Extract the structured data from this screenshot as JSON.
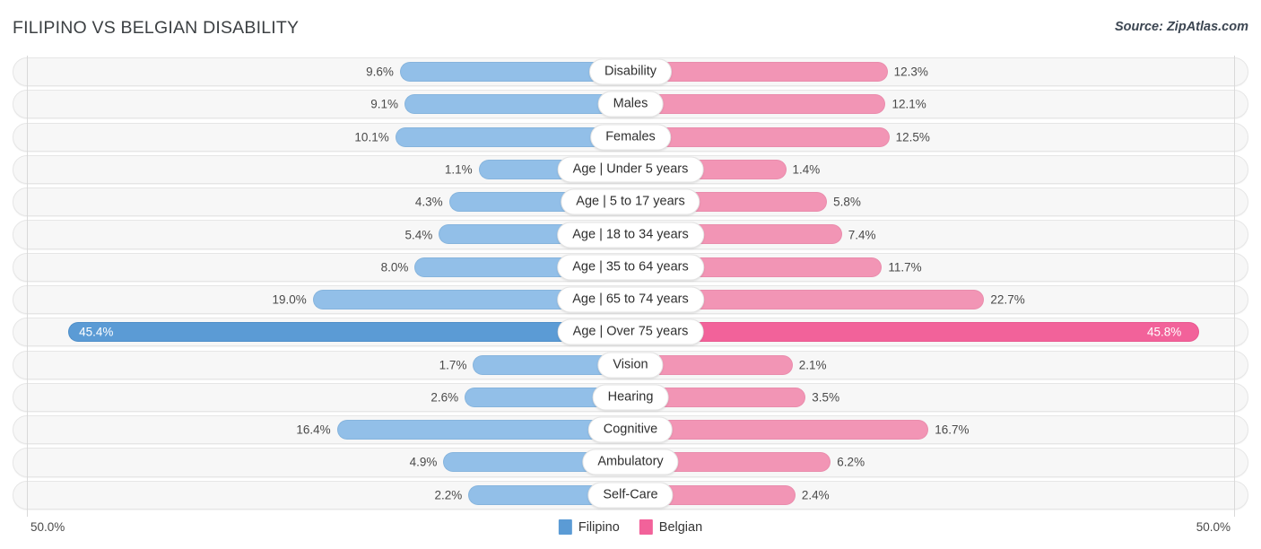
{
  "header": {
    "title": "FILIPINO VS BELGIAN DISABILITY",
    "source": "Source: ZipAtlas.com"
  },
  "axis": {
    "left_label": "50.0%",
    "right_label": "50.0%",
    "max": 50.0
  },
  "legend": {
    "items": [
      {
        "label": "Filipino",
        "color": "#5b9bd5"
      },
      {
        "label": "Belgian",
        "color": "#f2629a"
      }
    ]
  },
  "colors": {
    "left_bar": "#92bfe8",
    "right_bar": "#f295b5",
    "left_bar_highlight": "#5b9bd5",
    "right_bar_highlight": "#f2629a",
    "track": "#f7f7f7"
  },
  "chart_data": {
    "type": "bar",
    "title": "FILIPINO VS BELGIAN DISABILITY",
    "xlabel": "",
    "ylabel": "",
    "xlim": [
      0,
      50.0
    ],
    "grid": false,
    "legend_position": "bottom-center",
    "categories": [
      "Disability",
      "Males",
      "Females",
      "Age | Under 5 years",
      "Age | 5 to 17 years",
      "Age | 18 to 34 years",
      "Age | 35 to 64 years",
      "Age | 65 to 74 years",
      "Age | Over 75 years",
      "Vision",
      "Hearing",
      "Cognitive",
      "Ambulatory",
      "Self-Care"
    ],
    "series": [
      {
        "name": "Filipino",
        "color": "#5b9bd5",
        "values": [
          9.6,
          9.1,
          10.1,
          1.1,
          4.3,
          5.4,
          8.0,
          19.0,
          45.4,
          1.7,
          2.6,
          16.4,
          4.9,
          2.2
        ],
        "labels": [
          "9.6%",
          "9.1%",
          "10.1%",
          "1.1%",
          "4.3%",
          "5.4%",
          "8.0%",
          "19.0%",
          "45.4%",
          "1.7%",
          "2.6%",
          "16.4%",
          "4.9%",
          "2.2%"
        ]
      },
      {
        "name": "Belgian",
        "color": "#f2629a",
        "values": [
          12.3,
          12.1,
          12.5,
          1.4,
          5.8,
          7.4,
          11.7,
          22.7,
          45.8,
          2.1,
          3.5,
          16.7,
          6.2,
          2.4
        ],
        "labels": [
          "12.3%",
          "12.1%",
          "12.5%",
          "1.4%",
          "5.8%",
          "7.4%",
          "11.7%",
          "22.7%",
          "45.8%",
          "2.1%",
          "3.5%",
          "16.7%",
          "6.2%",
          "2.4%"
        ]
      }
    ],
    "highlighted_rows": [
      "Age | Over 75 years"
    ]
  }
}
